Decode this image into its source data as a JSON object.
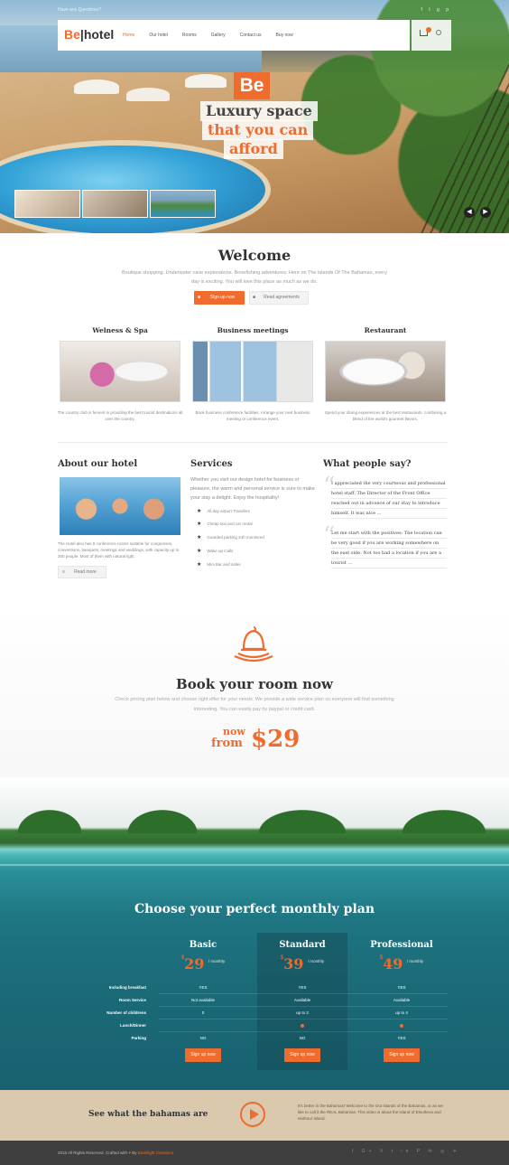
{
  "topbar": {
    "left_text": "Have any Questions?",
    "right_icons": [
      "facebook-icon",
      "twitter-icon",
      "google-icon",
      "pinterest-icon"
    ]
  },
  "brand": {
    "logo_be": "Be",
    "logo_rest": "hotel",
    "accent": "#ef6b2e"
  },
  "nav": {
    "items": [
      "Home",
      "Our hotel",
      "Rooms",
      "Gallery",
      "Contact us",
      "Buy now"
    ],
    "active": "Home"
  },
  "hero": {
    "badge": "Be",
    "line1": "Luxury space",
    "line2": "that you can",
    "line3": "afford"
  },
  "welcome": {
    "title": "Welcome",
    "text": "Boutique shopping. Underwater cave explorations. Bonefishing adventures. Here on The Islands Of The Bahamas, every day is exciting. You will love this place as much as we do.",
    "signup": "Sign up now",
    "read": "Read agreements"
  },
  "features": [
    {
      "title": "Welness & Spa",
      "text": "The country club is fervent in providing the best tourist destinations all over the country."
    },
    {
      "title": "Business meetings",
      "text": "Book business conference facilities. Arrange your next business meeting or conference event."
    },
    {
      "title": "Restaurant",
      "text": "Spend your dining experiences at the best restaurants, combining a blend of the world's gourmet flavors."
    }
  ],
  "about": {
    "title": "About our hotel",
    "text": "The Hotel also has 9 conference rooms suitable for congresses, conventions, banquets, meetings and weddings, with capacity up to 300 people. Most of them with natural light.",
    "read_more": "Read more"
  },
  "services": {
    "title": "Services",
    "intro": "Whether you visit our design hotel for business or pleasure, the warm and personal service is sure to make your stay a delight. Enjoy the hospitality!",
    "items": [
      "All day airport Transfers",
      "Cheap taxi and car rental",
      "Guarded parking 24h monitored",
      "Wake up Calls",
      "Mini Bar and safes"
    ]
  },
  "testimonials": {
    "title": "What people say?",
    "quotes": [
      "I appreciated the very courteous and professional hotel staff. The Director of the Front Office reached out in advance of our stay to introduce himself. It was nice ...",
      "Let me start with the positives: The location can be very good if you are working somewhere on the east side. Not too bad a location if you are a tourist ..."
    ]
  },
  "book": {
    "title": "Book your room now",
    "text": "Check pricing plan below and choose right offer for your needs. We provide a wide service plan so everyone will find something interesting. You can easily pay by paypal or credit card.",
    "now": "now",
    "from": "from",
    "price": "$29"
  },
  "plans": {
    "title": "Choose your perfect monthly plan",
    "rows": [
      "Including breakfast",
      "Room Service",
      "Number of childrens",
      "Lunch/Dinner",
      "Parking"
    ],
    "currency": "$",
    "period": "/ monthly",
    "button": "Sign up now",
    "items": [
      {
        "name": "Basic",
        "price": "29",
        "values": [
          "YES",
          "Not available",
          "0",
          "",
          "NO"
        ]
      },
      {
        "name": "Standard",
        "price": "39",
        "values": [
          "YES",
          "Available",
          "up to 2",
          "dot",
          "NO"
        ]
      },
      {
        "name": "Professional",
        "price": "49",
        "values": [
          "YES",
          "Available",
          "up to 4",
          "dot",
          "YES"
        ]
      }
    ]
  },
  "bahamas": {
    "title": "See what the bahamas are",
    "text": "It's better in the Bahamas! Welcome to the Out Islands of the Bahamas, or as we like to call it the REAL Bahamas. This video is about the island of Eleuthera and Harbour Island."
  },
  "footer": {
    "copy": "2018 All Rights Reserved. Crafted with",
    "by": "By",
    "brand": "Brainlight Creations"
  }
}
